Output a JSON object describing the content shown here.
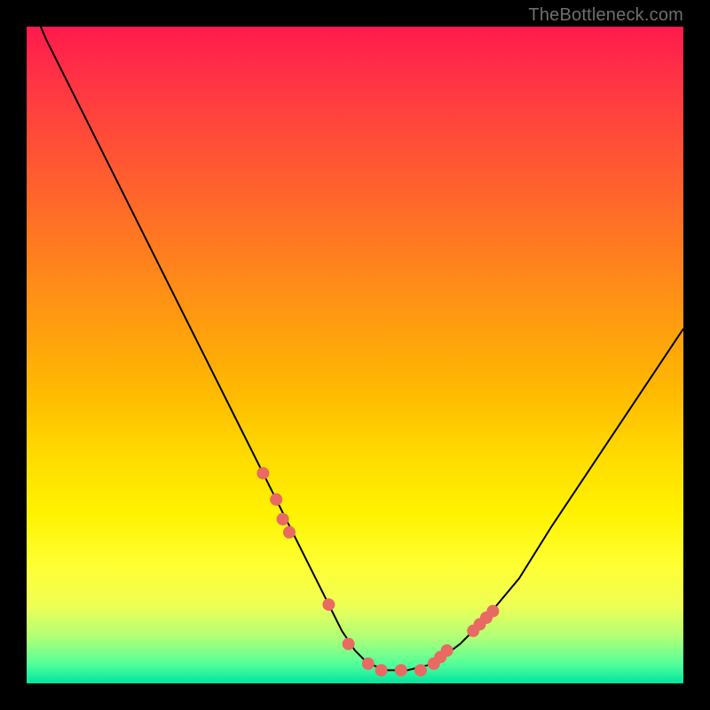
{
  "watermark": "TheBottleneck.com",
  "colors": {
    "background": "#000000",
    "gradient_top": "#ff1a4d",
    "gradient_bottom": "#00e59e",
    "curve": "#000000",
    "dots": "#e86a62",
    "watermark_text": "#6e6e6e"
  },
  "chart_data": {
    "type": "line",
    "title": "",
    "xlabel": "",
    "ylabel": "",
    "xlim": [
      0,
      100
    ],
    "ylim": [
      0,
      100
    ],
    "grid": false,
    "series": [
      {
        "name": "bottleneck-curve",
        "x": [
          0,
          3,
          8,
          14,
          20,
          26,
          32,
          38,
          44,
          48,
          50,
          52,
          55,
          58,
          62,
          66,
          70,
          75,
          80,
          86,
          92,
          100
        ],
        "values": [
          105,
          98,
          88,
          76,
          64,
          52,
          40,
          28,
          16,
          8,
          5,
          3,
          2,
          2,
          3,
          6,
          10,
          16,
          24,
          33,
          42,
          54
        ]
      }
    ],
    "highlighted_points": {
      "name": "marker-dots",
      "x": [
        36,
        38,
        39,
        40,
        46,
        49,
        52,
        54,
        57,
        60,
        62,
        63,
        64,
        68,
        69,
        70,
        71
      ],
      "values": [
        32,
        28,
        25,
        23,
        12,
        6,
        3,
        2,
        2,
        2,
        3,
        4,
        5,
        8,
        9,
        10,
        11
      ]
    }
  }
}
